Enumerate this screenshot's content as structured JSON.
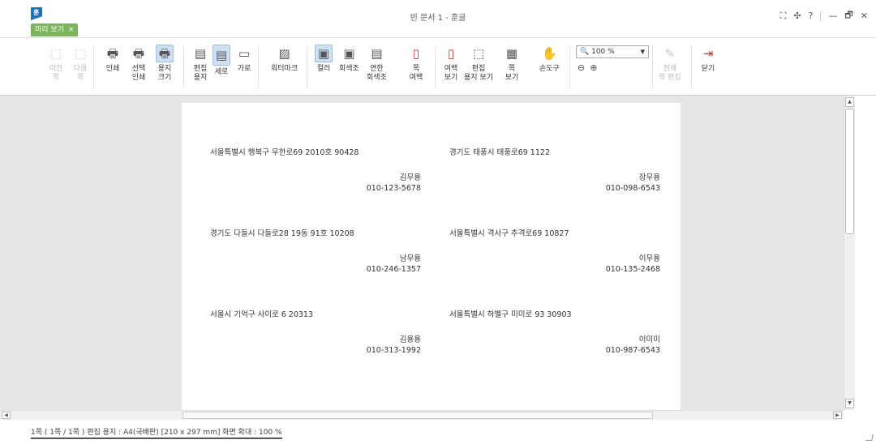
{
  "window": {
    "title": "빈 문서 1 - 훈글",
    "tab_label": "미리 보기",
    "tab_close": "×",
    "controls": [
      "⛶",
      "✣",
      "?",
      "—",
      "🗗",
      "✕"
    ]
  },
  "ribbon": {
    "prev_page": "이전\n쪽",
    "next_page": "다음\n쪽",
    "print": "인쇄",
    "print_selected": "선택\n인쇄",
    "paper_size": "용지\n크기",
    "edit_paper": "편집\n용지",
    "portrait": "세로",
    "landscape": "가로",
    "watermark": "워터마크",
    "color": "컬러",
    "grayscale": "회색조",
    "light_grayscale": "연한\n회색조",
    "page_margin": "쪽\n여백",
    "margin_view": "여백\n보기",
    "edit_paper_view": "편집\n용지 보기",
    "page_view": "쪽\n보기",
    "hand_tool": "손도구",
    "zoom_value": "100 %",
    "current_page_edit": "현재\n쪽 편집",
    "close": "닫기"
  },
  "labels": [
    {
      "addr": "서울특별시 행복구 무한로69 2010호  90428",
      "name": "김무용",
      "phone": "010-123-5678"
    },
    {
      "addr": "경기도 태풍시 태풍로69   1122",
      "name": "장무용",
      "phone": "010-098-6543"
    },
    {
      "addr": "경기도 다들시 다들로28 19동 91호  10208",
      "name": "남무용",
      "phone": "010-246-1357"
    },
    {
      "addr": "서울특별시 격사구 추격로69  10827",
      "name": "이무용",
      "phone": "010-135-2468"
    },
    {
      "addr": "서울시 기억구 사이로 6  20313",
      "name": "김용용",
      "phone": "010-313-1992"
    },
    {
      "addr": "서울특별시 하벨구 미미로 93  30903",
      "name": "이미미",
      "phone": "010-987-6543"
    }
  ],
  "statusbar": {
    "text": "1쪽 ( 1쪽 / 1쪽 ) 편집 용지 : A4(국배판)  [210 x 297 mm]  화면 확대 : 100 %"
  }
}
